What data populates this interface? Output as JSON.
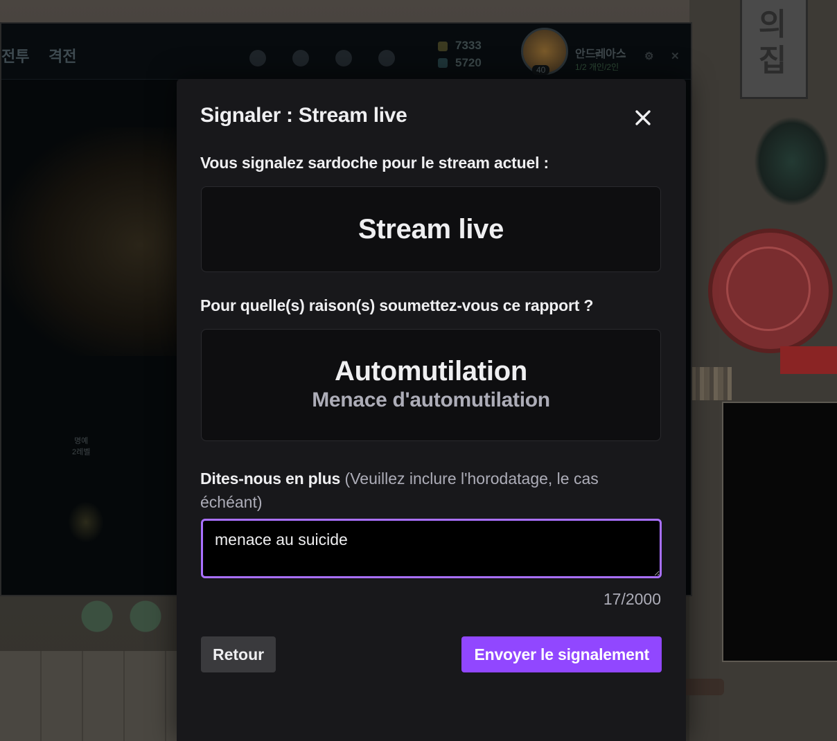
{
  "background": {
    "nav_tabs": [
      "전투",
      "격전"
    ],
    "currency": {
      "blue_essence": "7333",
      "orange_essence": "5720"
    },
    "profile": {
      "username": "안드레아스",
      "level": "40",
      "status": "1/2 개인/2인"
    },
    "window_controls": [
      "?",
      "–",
      "⚙",
      "✕"
    ],
    "rank_text": [
      "명예",
      "2레벨"
    ],
    "sign_text": "의집"
  },
  "modal": {
    "title": "Signaler : Stream live",
    "close_icon": "close-icon",
    "target_label": "Vous signalez sardoche pour le stream actuel :",
    "target_value": "Stream live",
    "reason_label": "Pour quelle(s) raison(s) soumettez-vous ce rapport ?",
    "reason_title": "Automutilation",
    "reason_subtitle": "Menace d'automutilation",
    "details_label": "Dites-nous en plus",
    "details_hint": "(Veuillez inclure l'horodatage, le cas échéant)",
    "details_value": "menace au suicide",
    "char_counter": "17/2000",
    "back_label": "Retour",
    "submit_label": "Envoyer le signalement"
  },
  "colors": {
    "accent": "#9147ff",
    "focus_border": "#a970ff",
    "modal_bg": "#18181b"
  }
}
